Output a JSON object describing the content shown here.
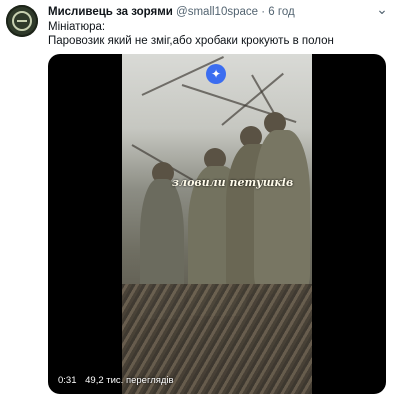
{
  "tweet": {
    "author_name": "Мисливець за зорями",
    "handle": "@small10space",
    "separator": "·",
    "time": "6 год",
    "more_icon": "more-options-icon",
    "text_line1": "Мініатюра:",
    "text_line2": "Паровозик який не зміг,або хробаки крокують в полон"
  },
  "media": {
    "overlay_caption": "зловили петушків",
    "duration": "0:31",
    "views": "49,2 тис. переглядів",
    "sparkle_icon": "sparkle-icon"
  },
  "colors": {
    "text_primary": "#0f1419",
    "text_secondary": "#536471",
    "media_background": "#000000"
  }
}
